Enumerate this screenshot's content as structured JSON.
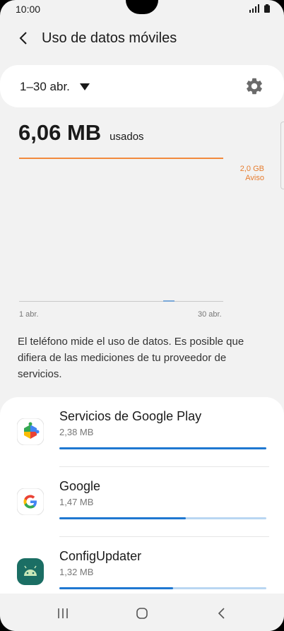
{
  "status_bar": {
    "time": "10:00"
  },
  "header": {
    "title": "Uso de datos móviles"
  },
  "period": {
    "label": "1–30 abr."
  },
  "usage": {
    "value": "6,06 MB",
    "label": "usados"
  },
  "chart": {
    "warning_value": "2,0 GB",
    "warning_label": "Aviso",
    "x_start": "1 abr.",
    "x_end": "30 abr."
  },
  "info_text": "El teléfono mide el uso de datos. Es posible que difiera de las mediciones de tu proveedor de servicios.",
  "apps": [
    {
      "name": "Servicios de Google Play",
      "size": "2,38 MB",
      "usage_fraction": 1.0
    },
    {
      "name": "Google",
      "size": "1,47 MB",
      "usage_fraction": 0.61
    },
    {
      "name": "ConfigUpdater",
      "size": "1,32 MB",
      "usage_fraction": 0.55
    }
  ],
  "colors": {
    "accent_blue": "#1f78d1",
    "warning_orange": "#e67c2e"
  }
}
